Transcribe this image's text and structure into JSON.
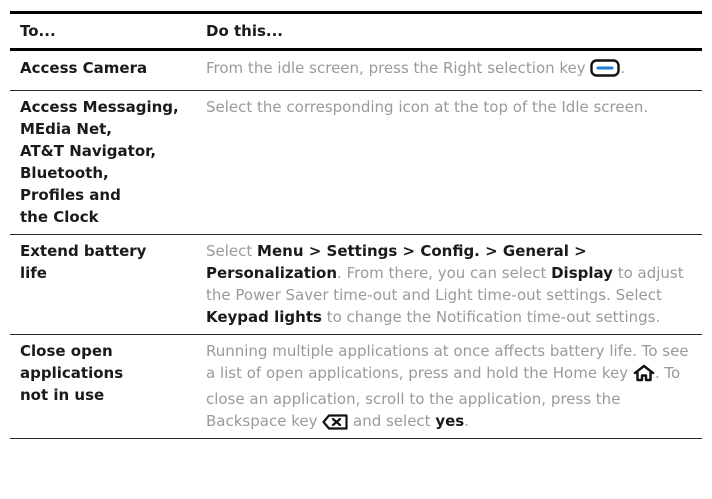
{
  "header": {
    "col1": "To...",
    "col2": "Do this..."
  },
  "rows": [
    {
      "to": "Access Camera",
      "do_text": "From the idle screen, press the Right selection key",
      "do_end": ".",
      "icon": "right-selection-key-icon"
    },
    {
      "to_lines": [
        "Access Messaging,",
        "MEdia Net,",
        "AT&T Navigator,",
        "Bluetooth,",
        "Profiles and",
        "the Clock"
      ],
      "do_text": "Select the corresponding icon at the top of the Idle screen."
    },
    {
      "to_lines": [
        "Extend battery",
        "life"
      ],
      "do_pre": "Select ",
      "do_b1": "Menu > Settings > Config. > General > Personalization",
      "do_mid1": ". From there, you can select ",
      "do_b2": "Display",
      "do_mid2": " to adjust the Power Saver time-out and Light time-out settings. Select ",
      "do_b3": "Keypad lights",
      "do_end": " to change the Notification time-out settings."
    },
    {
      "to_lines": [
        "Close open",
        "applications",
        "not in use"
      ],
      "do_pre": "Running multiple applications at once affects battery life. To see a list of open applications, press and hold the Home key",
      "do_mid1": ". To close an application, scroll to the application, press the Backspace key",
      "do_mid2": " and select ",
      "do_b1": "yes",
      "do_end": ".",
      "icons": [
        "home-key-icon",
        "backspace-key-icon"
      ]
    }
  ],
  "colors": {
    "body_text": "#9a9a9a",
    "emphasis_text": "#1a1a1a",
    "key_icon_accent": "#1e7fd6"
  }
}
